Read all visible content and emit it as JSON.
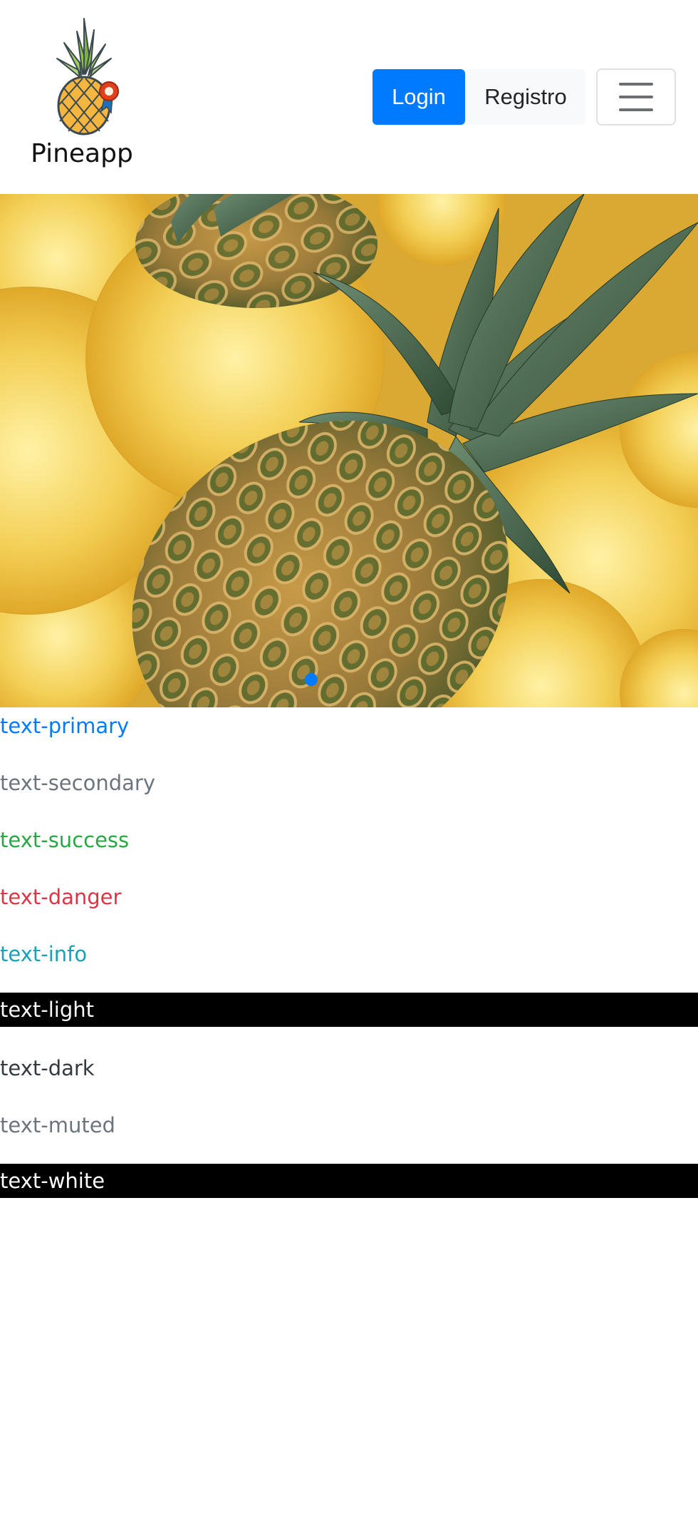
{
  "navbar": {
    "brand_name": "Pineapp",
    "login_label": "Login",
    "register_label": "Registro",
    "toggler_icon": "hamburger-menu-icon"
  },
  "hero": {
    "image_subject": "pineapple-photo",
    "active_slide_index": 0,
    "slide_count": 1
  },
  "colors": {
    "primary": "#007bff",
    "secondary": "#6c757d",
    "success": "#28a745",
    "danger": "#dc3545",
    "info": "#17a2b8",
    "light": "#f8f9fa",
    "dark": "#343a40",
    "muted": "#6c757d",
    "white": "#ffffff"
  },
  "text_samples": {
    "primary": "text-primary",
    "secondary": "text-secondary",
    "success": "text-success",
    "danger": "text-danger",
    "info": "text-info",
    "light": "text-light",
    "dark": "text-dark",
    "muted": "text-muted",
    "white": "text-white"
  }
}
